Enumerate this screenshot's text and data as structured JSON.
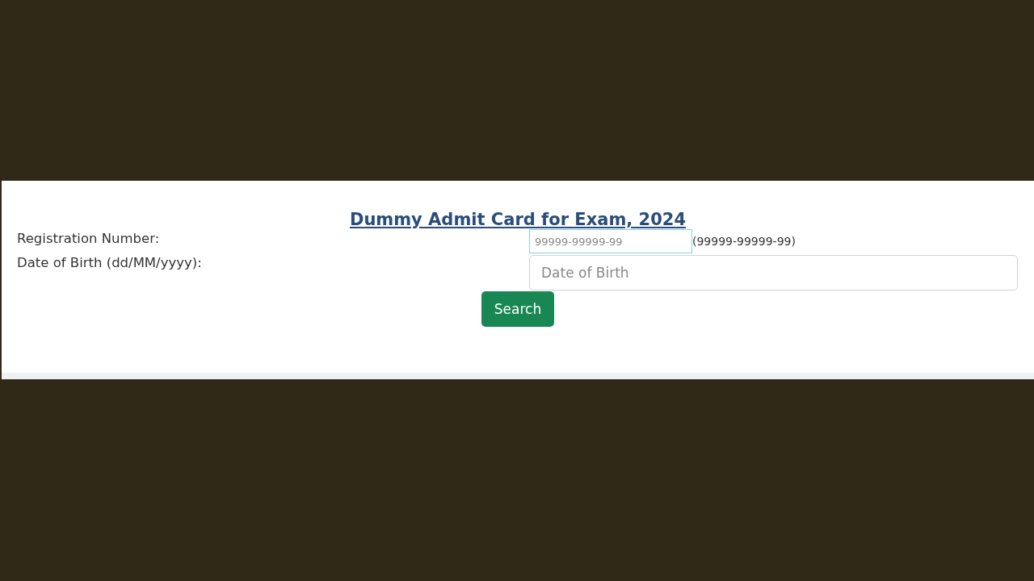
{
  "form": {
    "title": "Dummy Admit Card for Exam, 2024",
    "fields": [
      {
        "label": "Registration Number:",
        "placeholder": "99999-99999-99",
        "hint": "(99999-99999-99)",
        "focused": true
      },
      {
        "label": "Date of Birth (dd/MM/yyyy):",
        "placeholder": "Date of Birth",
        "focused": false
      }
    ],
    "button": "Search"
  }
}
